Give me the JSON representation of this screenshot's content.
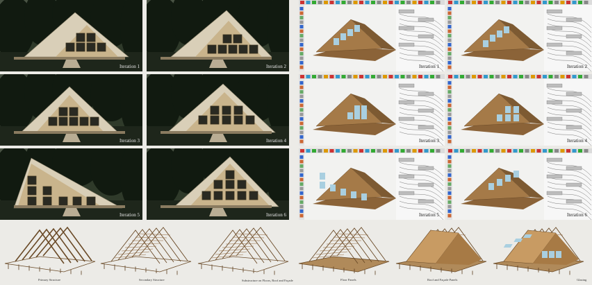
{
  "renders": [
    {
      "label": "Iteration 1"
    },
    {
      "label": "Iteration 2"
    },
    {
      "label": "Iteration 3"
    },
    {
      "label": "Iteration 4"
    },
    {
      "label": "Iteration 5"
    },
    {
      "label": "Iteration 6"
    }
  ],
  "cad_views": [
    {
      "label": "Iteration 1"
    },
    {
      "label": "Iteration 2"
    },
    {
      "label": "Iteration 3"
    },
    {
      "label": "Iteration 4"
    },
    {
      "label": "Iteration 5"
    },
    {
      "label": "Iteration 6"
    }
  ],
  "stages": [
    {
      "label": "Primary Structure"
    },
    {
      "label": "Secondary Structure"
    },
    {
      "label": "Substructure on Floors, Roof and Façade"
    },
    {
      "label": "Floor Panels"
    },
    {
      "label": "Roof and Façade Panels"
    },
    {
      "label": "Glazing"
    }
  ],
  "colors": {
    "forest": "#1b2a1a",
    "timber_light": "#d9cfb8",
    "timber_cad": "#9b7142",
    "glass": "#a9cfe0",
    "background": "#ecebe7"
  }
}
